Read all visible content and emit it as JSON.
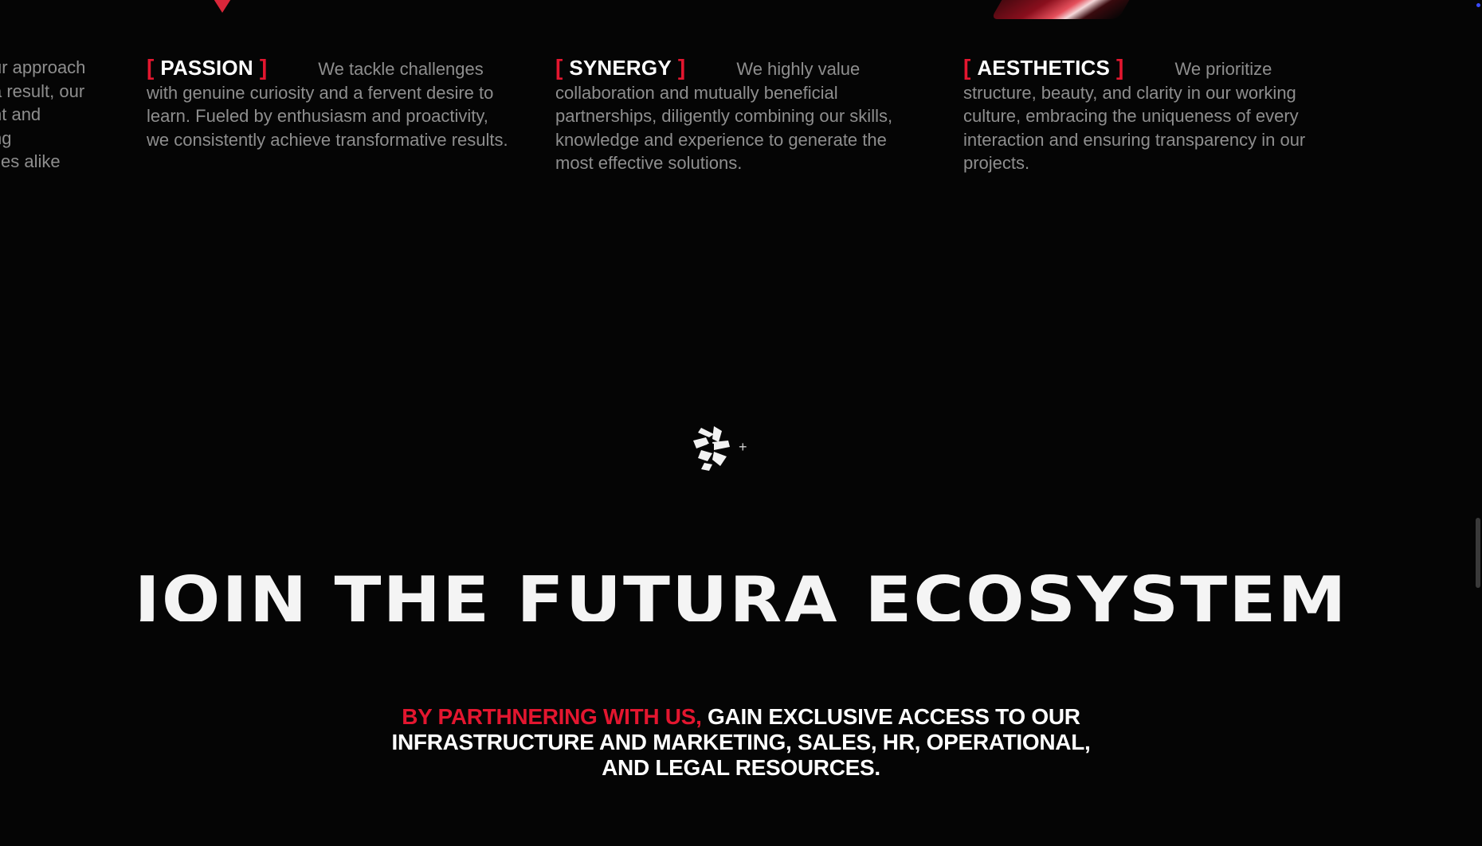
{
  "colors": {
    "background": "#050505",
    "accent": "#e3162f",
    "body_text": "#8e8e8e",
    "heading": "#ffffff"
  },
  "values": {
    "cut_left_lines": [
      "ur approach",
      "a result, our",
      "ht and",
      "ng",
      "ies alike."
    ],
    "items": [
      {
        "title": "PASSION",
        "lead": "We tackle challenges",
        "body": "with genuine curiosity and a fervent desire to learn. Fueled by enthusiasm and proactivity, we consistently achieve transformative results."
      },
      {
        "title": "SYNERGY",
        "lead": "We highly value",
        "body": "collaboration and mutually beneficial partnerships, diligently combining our skills, knowledge and experience to generate the most effective solutions."
      },
      {
        "title": "AESTHETICS",
        "lead": "We prioritize",
        "body": "structure, beauty, and clarity in our working culture, embracing the uniqueness of every interaction and ensuring transparency in our projects."
      }
    ],
    "bracket_open": "[",
    "bracket_close": "]"
  },
  "logo": {
    "icon": "futura-logo-icon",
    "plus": "+"
  },
  "headline": "JOIN THE FUTURA ECOSYSTEM",
  "tagline": {
    "accent_part": "BY PARTHNERING WITH US,",
    "rest_line1": "GAIN EXCLUSIVE ACCESS TO OUR",
    "rest_line2": "INFRASTRUCTURE AND MARKETING, SALES, HR, OPERATIONAL,",
    "rest_line3": "AND LEGAL RESOURCES."
  }
}
